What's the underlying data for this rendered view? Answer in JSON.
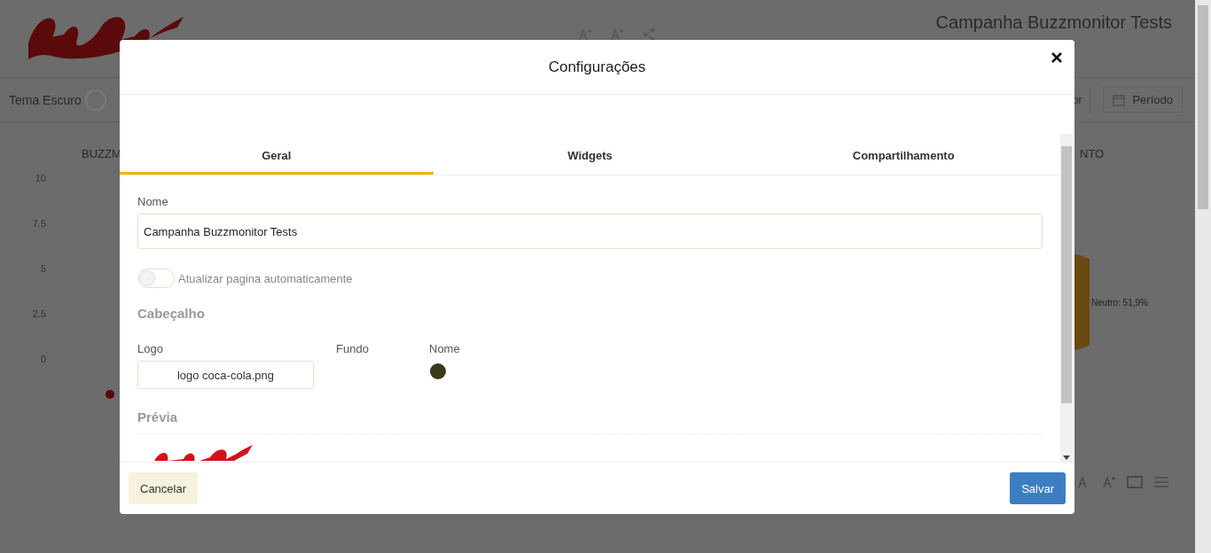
{
  "background": {
    "header_title": "Campanha Buzzmonitor Tests",
    "theme_toggle": {
      "label": "Tema Escuro",
      "on": false
    },
    "toolbar": [
      {
        "kind": "text",
        "label": "or"
      },
      {
        "kind": "button",
        "label": "Período"
      }
    ],
    "left_chart": {
      "title": "BUZZM",
      "y_axis_labels": [
        "10",
        "7.5",
        "5",
        "2.5",
        "0"
      ]
    },
    "right_chart": {
      "title": "NTO",
      "slice_label": "Neutro: 51,9%"
    }
  },
  "modal": {
    "title": "Configurações",
    "tabs": [
      {
        "label": "Geral",
        "selected": true
      },
      {
        "label": "Widgets",
        "selected": false
      },
      {
        "label": "Compartilhamento",
        "selected": false
      }
    ],
    "name_field": {
      "label": "Nome",
      "value": "Campanha Buzzmonitor Tests"
    },
    "auto_refresh": {
      "label": "Atualizar pagina automaticamente",
      "on": false
    },
    "section_title": "Cabeçalho",
    "header_fields": [
      {
        "kind": "file",
        "label": "Logo",
        "value": "logo coca-cola.png"
      },
      {
        "kind": "color",
        "label": "Fundo"
      },
      {
        "kind": "color",
        "label": "Nome",
        "color": "#3a3a1c"
      }
    ],
    "preview_title": "Prévia",
    "buttons": [
      {
        "kind": "secondary",
        "label": "Cancelar"
      },
      {
        "kind": "primary",
        "label": "Salvar"
      }
    ]
  }
}
